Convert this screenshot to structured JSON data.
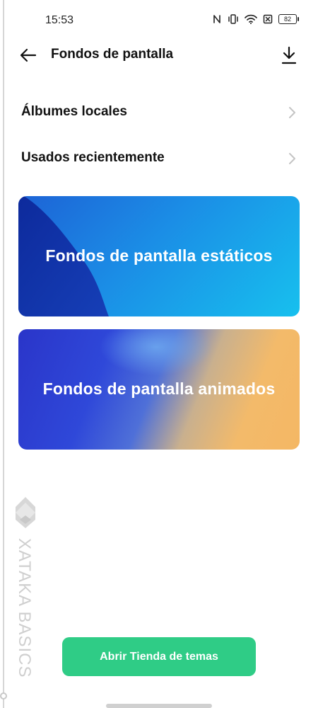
{
  "status_bar": {
    "time": "15:53",
    "battery": "82",
    "icons": [
      "nfc-icon",
      "vibrate-icon",
      "wifi-icon",
      "no-sim-icon",
      "battery-icon"
    ]
  },
  "header": {
    "title": "Fondos de pantalla",
    "back_icon": "arrow-left-icon",
    "download_icon": "download-icon"
  },
  "list": [
    {
      "label": "Álbumes locales"
    },
    {
      "label": "Usados recientemente"
    }
  ],
  "cards": [
    {
      "title": "Fondos de pantalla estáticos",
      "colors": [
        "#1d63d6",
        "#17c0ee",
        "#0d2a9c"
      ]
    },
    {
      "title": "Fondos de pantalla animados",
      "colors": [
        "#2a35c9",
        "#f4b764"
      ]
    }
  ],
  "watermark": {
    "text": "XATAKA BASICS"
  },
  "store_button": {
    "label": "Abrir Tienda de temas",
    "color": "#2fcc86"
  }
}
